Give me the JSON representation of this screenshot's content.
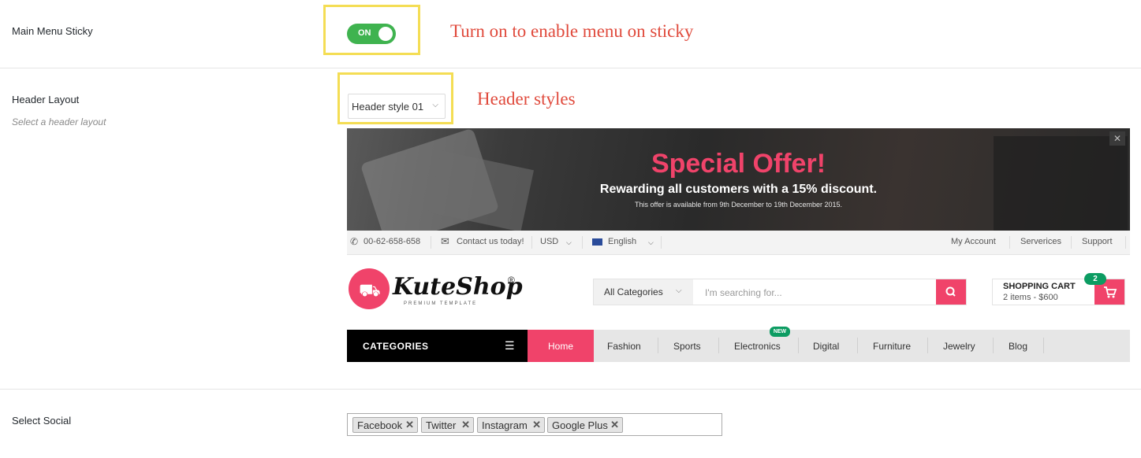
{
  "settings": {
    "main_menu_sticky": {
      "label": "Main Menu Sticky",
      "toggle_text": "ON",
      "annotation": "Turn on to enable menu on sticky"
    },
    "header_layout": {
      "label": "Header Layout",
      "description": "Select a header layout",
      "selected": "Header style 01",
      "annotation": "Header styles"
    },
    "select_social": {
      "label": "Select Social",
      "tags": [
        "Facebook",
        "Twitter",
        "Instagram",
        "Google Plus"
      ]
    }
  },
  "preview": {
    "banner": {
      "title": "Special Offer!",
      "subtitle": "Rewarding all customers with a 15% discount.",
      "note": "This offer is available from 9th December to 19th December 2015.",
      "close": "✕"
    },
    "topbar": {
      "phone": "00-62-658-658",
      "contact": "Contact us today!",
      "currency": "USD",
      "language": "English",
      "links": [
        "My Account",
        "Serverices",
        "Support"
      ]
    },
    "logo": {
      "text": "KuteShop",
      "reg": "®",
      "tagline": "PREMIUM TEMPLATE"
    },
    "search": {
      "category": "All Categories",
      "placeholder": "I'm searching for..."
    },
    "cart": {
      "title": "SHOPPING CART",
      "items": "2 items - $600",
      "badge": "2"
    },
    "nav": {
      "categories_label": "CATEGORIES",
      "home": "Home",
      "items": [
        "Fashion",
        "Sports",
        "Electronics",
        "Digital",
        "Furniture",
        "Jewelry",
        "Blog"
      ],
      "new_tag": "NEW"
    }
  },
  "colors": {
    "accent": "#f0436a",
    "toggle_on": "#3fb34f",
    "highlight_box": "#f4dd54",
    "annotation_text": "#e04a3c",
    "badge_green": "#0c9c62"
  }
}
